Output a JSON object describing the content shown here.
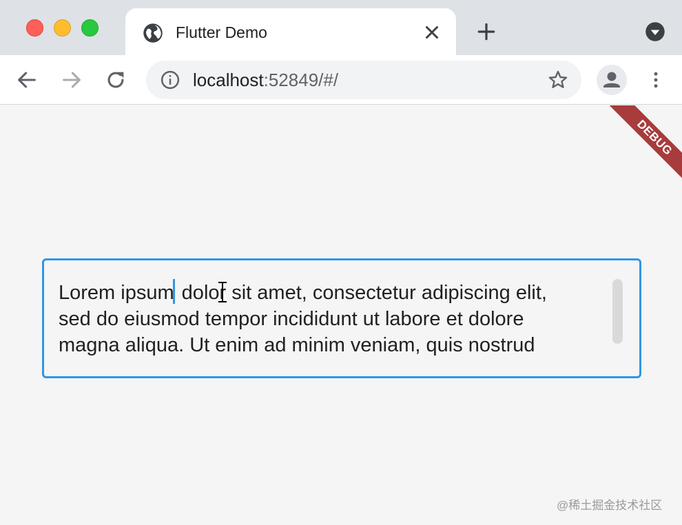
{
  "browser": {
    "tab": {
      "title": "Flutter Demo",
      "icon": "globe-icon"
    },
    "address_bar": {
      "host": "localhost",
      "rest": ":52849/#/"
    },
    "icons": {
      "back": "arrow-left-icon",
      "forward": "arrow-right-icon",
      "reload": "reload-icon",
      "info": "info-icon",
      "bookmark": "star-icon",
      "profile": "person-icon",
      "menu": "more-vert-icon",
      "new_tab": "plus-icon",
      "tab_search": "chevron-down-icon",
      "close_tab": "close-icon"
    },
    "colors": {
      "tabstrip": "#dee1e6",
      "omnibox": "#f1f3f4"
    }
  },
  "app": {
    "debug_banner": "DEBUG",
    "text_field": {
      "lines": [
        "Lorem ipsum dolor sit amet, consectetur adipiscing elit,",
        "sed do eiusmod tempor incididunt ut labore et dolore",
        "magna aliqua. Ut enim ad minim veniam, quis nostrud"
      ],
      "line1_before_caret": "Lorem ipsum",
      "line1_after_caret": " dolor sit amet, consectetur adipiscing elit,",
      "border_color": "#2f96e6"
    },
    "watermark": "@稀土掘金技术社区"
  }
}
